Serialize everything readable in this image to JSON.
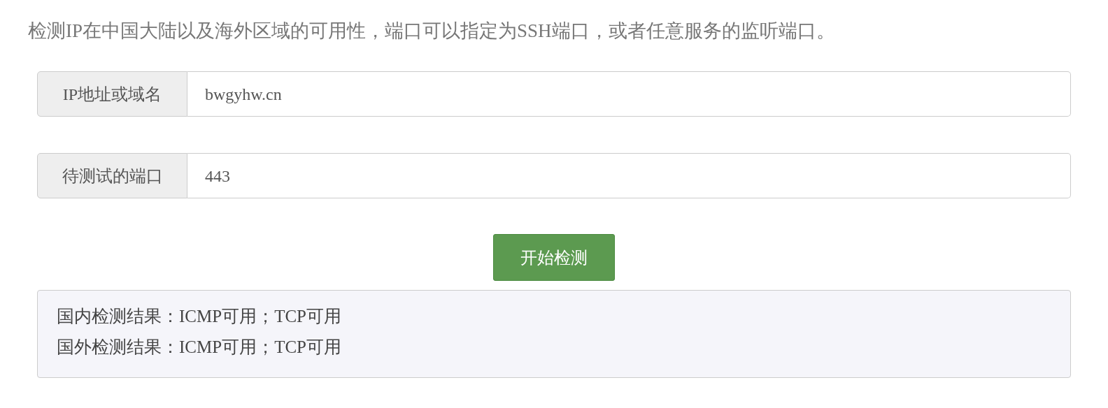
{
  "description": "检测IP在中国大陆以及海外区域的可用性，端口可以指定为SSH端口，或者任意服务的监听端口。",
  "fields": [
    {
      "label": "IP地址或域名",
      "value": "bwgyhw.cn"
    },
    {
      "label": "待测试的端口",
      "value": "443"
    }
  ],
  "button": "开始检测",
  "results": [
    "国内检测结果：ICMP可用；TCP可用",
    "国外检测结果：ICMP可用；TCP可用"
  ]
}
